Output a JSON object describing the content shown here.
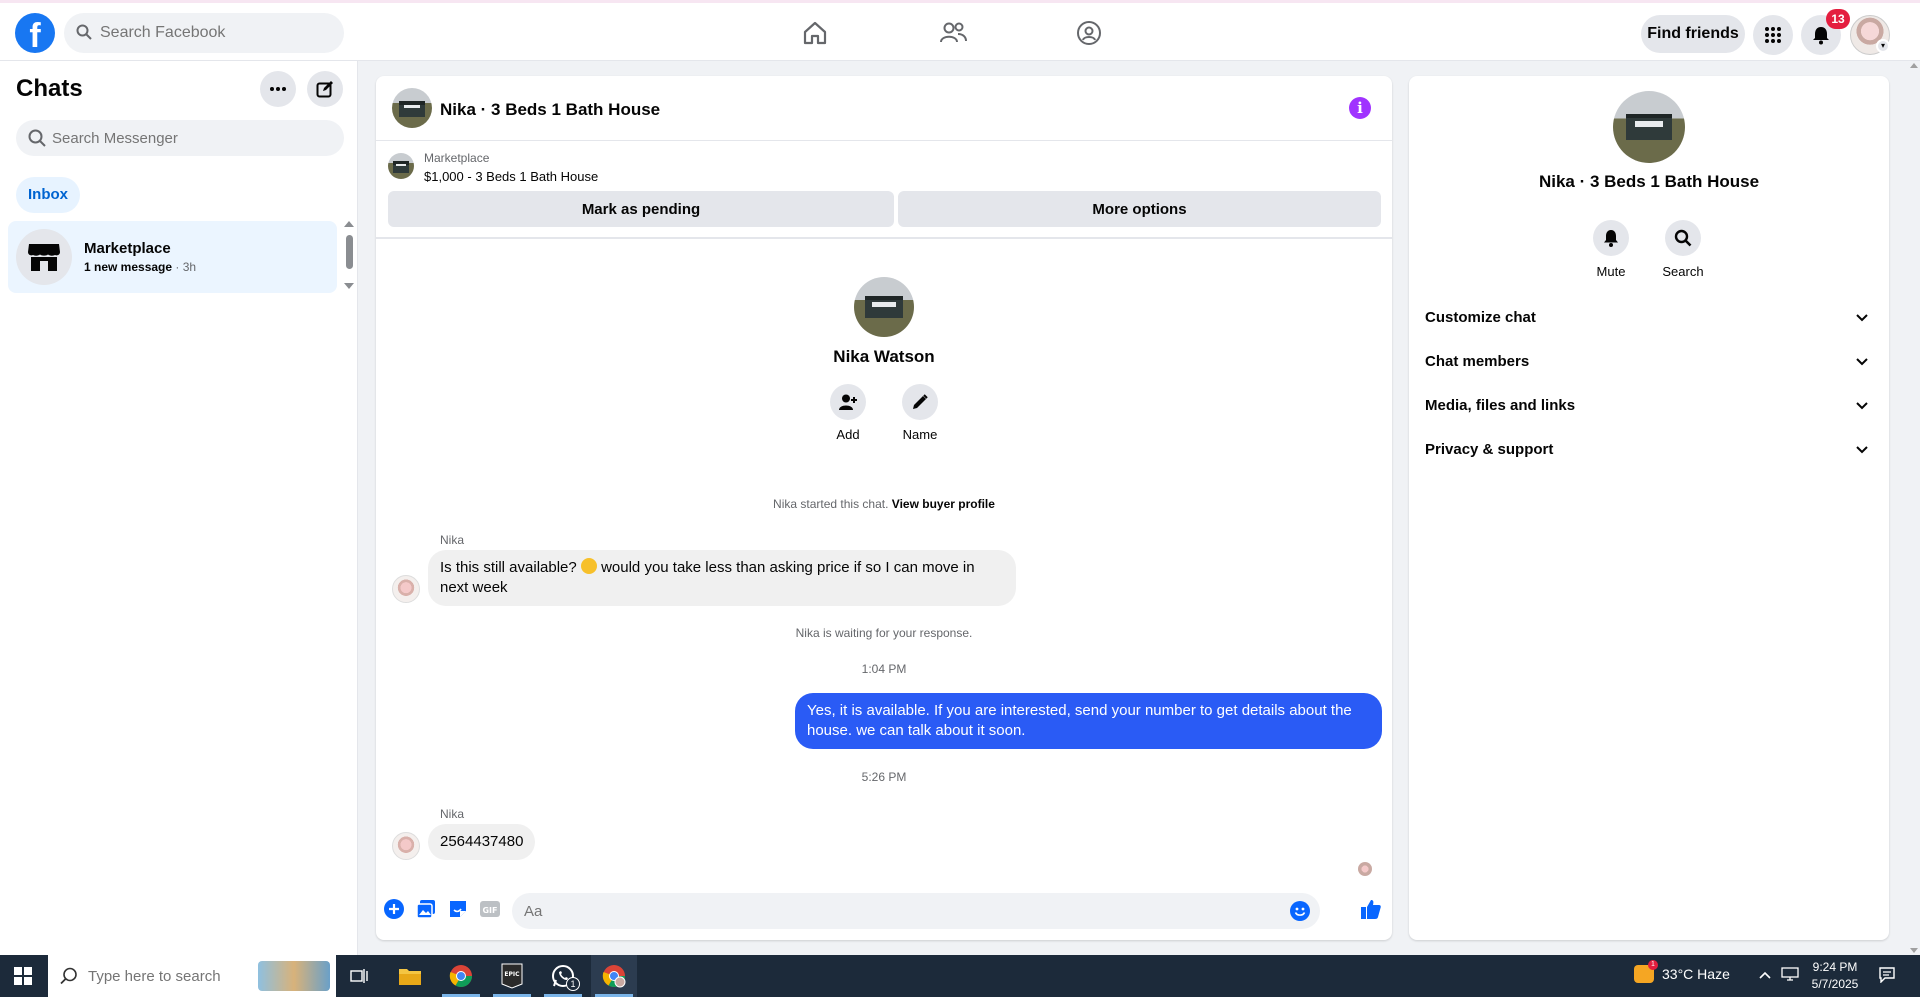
{
  "topbar": {
    "logo_letter": "f",
    "search_placeholder": "Search Facebook",
    "nav_icons": [
      "home-icon",
      "friends-icon",
      "groups-icon"
    ],
    "find_friends_label": "Find friends",
    "notification_count": "13"
  },
  "sidebar": {
    "title": "Chats",
    "search_placeholder": "Search Messenger",
    "filter_label": "Inbox",
    "conversations": [
      {
        "name": "Marketplace",
        "preview": "1 new message",
        "time": " · 3h"
      }
    ]
  },
  "chat": {
    "title": "Nika · 3 Beds 1 Bath House",
    "marketplace_label": "Marketplace",
    "listing": "$1,000 - 3 Beds 1 Bath House",
    "mark_pending_label": "Mark as pending",
    "more_options_label": "More options",
    "intro_name": "Nika Watson",
    "intro_actions": [
      {
        "label": "Add",
        "icon": "add-person-icon"
      },
      {
        "label": "Name",
        "icon": "pencil-icon"
      }
    ],
    "started_text": "Nika started this chat.",
    "view_profile_label": "View buyer profile",
    "messages": [
      {
        "sender": "Nika",
        "text_before": "Is this still available?",
        "text_after": "would you take less than asking price if so I can move in next week"
      },
      {
        "system": "Nika is waiting for your response."
      },
      {
        "time": "1:04 PM"
      },
      {
        "out": "Yes, it is available. If you are interested, send your number to get details about the house. we can talk about it soon."
      },
      {
        "time": "5:26 PM"
      },
      {
        "sender": "Nika",
        "text": "2564437480"
      }
    ],
    "composer_placeholder": "Aa"
  },
  "details": {
    "title": "Nika · 3 Beds 1 Bath House",
    "actions": [
      {
        "label": "Mute",
        "icon": "bell-icon"
      },
      {
        "label": "Search",
        "icon": "search-icon"
      }
    ],
    "sections": [
      "Customize chat",
      "Chat members",
      "Media, files and links",
      "Privacy & support"
    ]
  },
  "taskbar": {
    "search_placeholder": "Type here to search",
    "weather": "33°C  Haze",
    "weather_badge": "1",
    "whatsapp_badge": "1",
    "time": "9:24 PM",
    "date": "5/7/2025",
    "colors": {
      "accent": "#1877f2",
      "outgoing": "#2a5bf5",
      "badge": "#e41e3f"
    }
  }
}
